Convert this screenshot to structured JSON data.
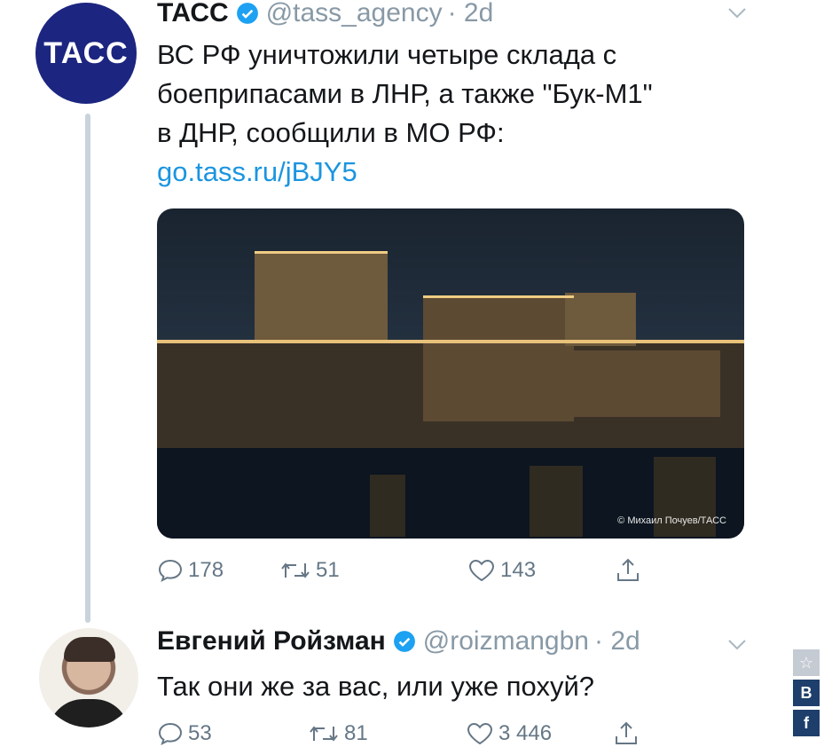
{
  "tweet1": {
    "avatar_text": "ТАСС",
    "name": "ТАСС",
    "handle": "@tass_agency",
    "time": "· 2d",
    "lines": [
      "ВС РФ уничтожили четыре склада с",
      "боеприпасами в ЛНР, а также \"Бук-М1\"",
      "в ДНР, сообщили в МО РФ:"
    ],
    "link": "go.tass.ru/jBJY5",
    "photo_credit": "© Михаил Почуев/ТАСС",
    "replies": "178",
    "retweets": "51",
    "likes": "143"
  },
  "tweet2": {
    "name": "Евгений Ройзман",
    "handle": "@roizmangbn",
    "time": "· 2d",
    "text": "Так они же за вас, или уже похуй?",
    "replies": "53",
    "retweets": "81",
    "likes": "3 446"
  },
  "side_buttons": [
    "☆",
    "В",
    "f"
  ],
  "colors": {
    "tass_blue": "#1c2580",
    "link": "#1b95e0",
    "muted": "#657786",
    "verified": "#1da1f2"
  }
}
